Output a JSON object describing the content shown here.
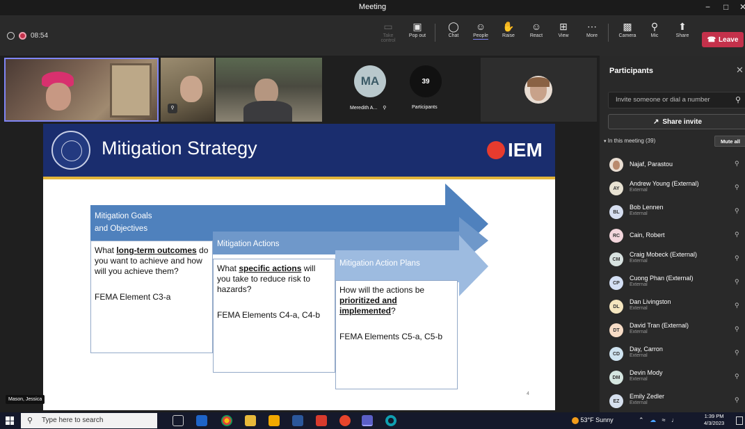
{
  "window": {
    "title": "Meeting",
    "min_glyph": "−",
    "max_glyph": "□",
    "close_glyph": "✕"
  },
  "toolbar": {
    "timer": "08:54",
    "items": {
      "take_control": "Take control",
      "pop_out": "Pop out",
      "chat": "Chat",
      "people": "People",
      "raise": "Raise",
      "react": "React",
      "view": "View",
      "more": "More",
      "camera": "Camera",
      "mic": "Mic",
      "share": "Share"
    },
    "leave": "Leave",
    "accent": "#c4314b"
  },
  "gallery": {
    "tile_ma_initials": "MA",
    "tile_ma_name": "Meredith A...",
    "participant_count": "39",
    "participants_label": "Participants"
  },
  "slide": {
    "title": "Mitigation Strategy",
    "logo_text": "IEM",
    "page_number": "4",
    "columns": [
      {
        "band_line1": "Mitigation Goals",
        "band_line2": "and Objectives",
        "q_pre": "What ",
        "q_emph": "long-term outcomes",
        "q_post": " do you want to achieve and how will you achieve them?",
        "element": "FEMA Element C3-a"
      },
      {
        "band_line1": "Mitigation Actions",
        "q_pre": "What ",
        "q_emph": "specific actions",
        "q_post": " will you take to reduce risk to hazards?",
        "element": "FEMA Elements C4-a, C4-b"
      },
      {
        "band_line1": "Mitigation Action Plans",
        "q_pre": "How will the actions be ",
        "q_emph": "prioritized and implemented",
        "q_post": "?",
        "element": "FEMA Elements C5-a, C5-b"
      }
    ],
    "colors": {
      "header": "#1a2d6e",
      "gold": "#e3b53a",
      "arrow1": "#4f81bd",
      "arrow2": "#6f98ca",
      "arrow3": "#9dbbe0"
    }
  },
  "presenter_tag": "Mason, Jessica",
  "panel": {
    "title": "Participants",
    "invite_placeholder": "Invite someone or dial a number",
    "share_invite": "Share invite",
    "in_meeting": "In this meeting (39)",
    "mute_all": "Mute all",
    "participants": [
      {
        "initials": "",
        "name": "Najaf, Parastou",
        "sub": "",
        "color": "#d9c8b8",
        "photo": true
      },
      {
        "initials": "AY",
        "name": "Andrew Young (External)",
        "sub": "External",
        "color": "#e8e2d2"
      },
      {
        "initials": "BL",
        "name": "Bob Lennen",
        "sub": "External",
        "color": "#d6def0"
      },
      {
        "initials": "RC",
        "name": "Cain, Robert",
        "sub": "",
        "color": "#f3d6dc"
      },
      {
        "initials": "CM",
        "name": "Craig Mobeck (External)",
        "sub": "External",
        "color": "#d8e2e0"
      },
      {
        "initials": "CP",
        "name": "Cuong Phan (External)",
        "sub": "External",
        "color": "#d4e0f5"
      },
      {
        "initials": "DL",
        "name": "Dan Livingston",
        "sub": "External",
        "color": "#f5e6bf"
      },
      {
        "initials": "DT",
        "name": "David Tran (External)",
        "sub": "External",
        "color": "#f7dcc6"
      },
      {
        "initials": "CD",
        "name": "Day, Carron",
        "sub": "External",
        "color": "#cfe3f0"
      },
      {
        "initials": "DM",
        "name": "Devin Mody",
        "sub": "External",
        "color": "#d5e6e0"
      },
      {
        "initials": "EZ",
        "name": "Emily Zedler",
        "sub": "External",
        "color": "#d6e0ee"
      }
    ]
  },
  "taskbar": {
    "search_placeholder": "Type here to search",
    "weather": "53°F  Sunny",
    "time": "1:39 PM",
    "date": "4/3/2023"
  }
}
